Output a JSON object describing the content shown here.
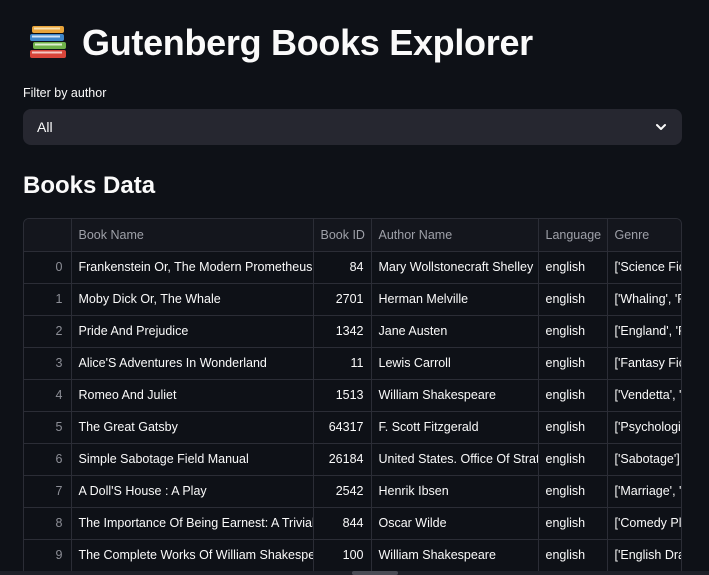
{
  "header": {
    "title": "Gutenberg Books Explorer",
    "icon": "books-icon"
  },
  "filter": {
    "label": "Filter by author",
    "selected": "All"
  },
  "section": {
    "title": "Books Data"
  },
  "table": {
    "columns": [
      "",
      "Book Name",
      "Book ID",
      "Author Name",
      "Language",
      "Genre"
    ],
    "rows": [
      [
        "0",
        "Frankenstein Or, The Modern Prometheus",
        "84",
        "Mary Wollstonecraft Shelley",
        "english",
        "['Science Fic"
      ],
      [
        "1",
        "Moby Dick Or, The Whale",
        "2701",
        "Herman Melville",
        "english",
        "['Whaling', 'F"
      ],
      [
        "2",
        "Pride And Prejudice",
        "1342",
        "Jane Austen",
        "english",
        "['England', 'F"
      ],
      [
        "3",
        "Alice'S Adventures In Wonderland",
        "11",
        "Lewis Carroll",
        "english",
        "['Fantasy Fic"
      ],
      [
        "4",
        "Romeo And Juliet",
        "1513",
        "William Shakespeare",
        "english",
        "['Vendetta', '"
      ],
      [
        "5",
        "The Great Gatsby",
        "64317",
        "F. Scott Fitzgerald",
        "english",
        "['Psychologi"
      ],
      [
        "6",
        "Simple Sabotage Field Manual",
        "26184",
        "United States. Office Of Strate",
        "english",
        "['Sabotage']"
      ],
      [
        "7",
        "A Doll'S House : A Play",
        "2542",
        "Henrik Ibsen",
        "english",
        "['Marriage', '"
      ],
      [
        "8",
        "The Importance Of Being Earnest: A Trivial C",
        "844",
        "Oscar Wilde",
        "english",
        "['Comedy Pl"
      ],
      [
        "9",
        "The Complete Works Of William Shakespea",
        "100",
        "William Shakespeare",
        "english",
        "['English Dra"
      ]
    ]
  },
  "colors": {
    "background": "#0e1117",
    "select_bg": "#262730",
    "grid_line": "#2b2d36",
    "header_text": "#9ea0a8"
  }
}
